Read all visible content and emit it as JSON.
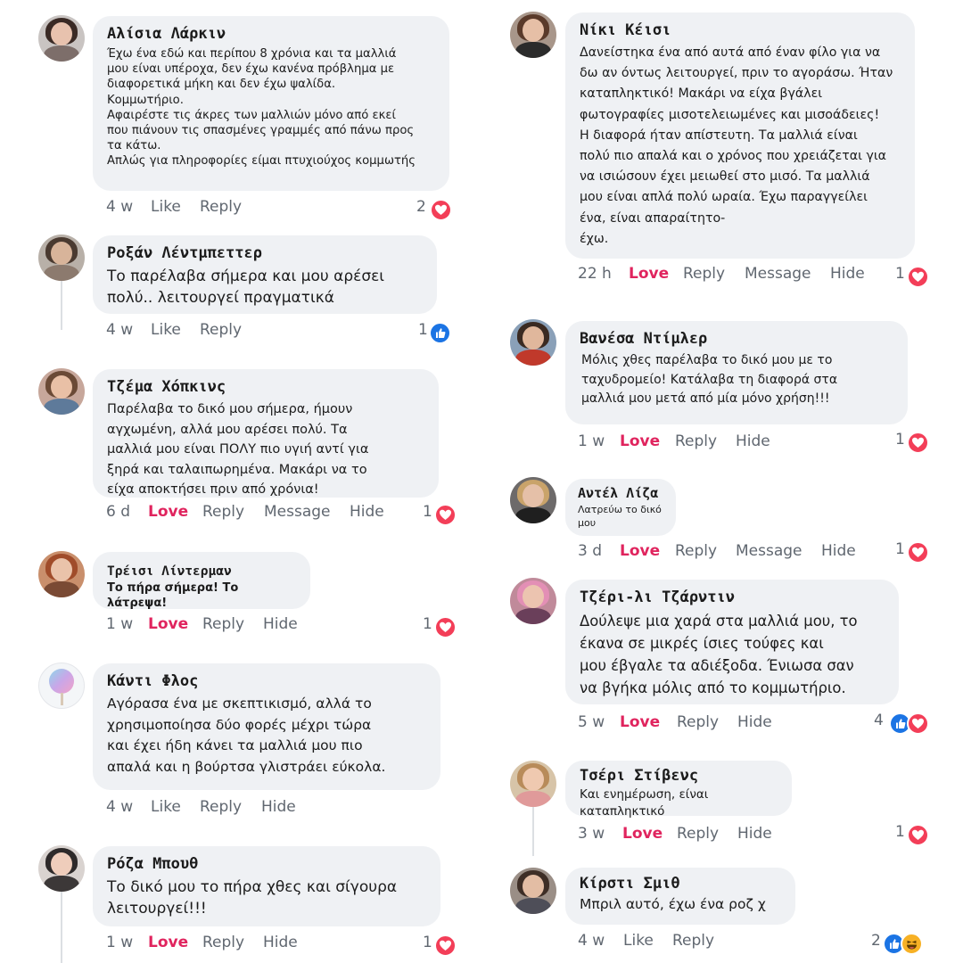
{
  "left": [
    {
      "author": "Αλίσια Λάρκιν",
      "text": "Έχω ένα εδώ και περίπου 8 χρόνια και τα μαλλιά\nμου είναι υπέροχα, δεν έχω κανένα πρόβλημα με\nδιαφορετικά μήκη και δεν έχω ψαλίδα.\nΚομμωτήριο.\nΑφαιρέστε τις άκρες των μαλλιών μόνο από εκεί\nπου πιάνουν τις σπασμένες γραμμές από πάνω προς\nτα κάτω.\nΑπλώς για πληροφορίες είμαι πτυχιούχος κομμωτής",
      "time": "4 w",
      "a1": "Like",
      "a2": "Reply",
      "count": "2"
    },
    {
      "author": "Ροξάν Λέντμπεττερ",
      "text": "Το παρέλαβα σήμερα και μου αρέσει\nπολύ.. λειτουργεί πραγματικά",
      "time": "4 w",
      "a1": "Like",
      "a2": "Reply",
      "count": "1"
    },
    {
      "author": "Τζέμα Χόπκινς",
      "text": "Παρέλαβα το δικό μου σήμερα, ήμουν\nαγχωμένη, αλλά μου αρέσει πολύ. Τα\nμαλλιά μου είναι ΠΟΛΥ πιο υγιή αντί για\nξηρά και ταλαιπωρημένα. Μακάρι να το\nείχα αποκτήσει πριν από χρόνια!",
      "time": "6 d",
      "a1": "Love",
      "a2": "Reply",
      "a3": "Message",
      "a4": "Hide",
      "count": "1"
    },
    {
      "author": "Τρέισι Λίντερμαν",
      "text": "Το πήρα σήμερα! Το λάτρεψα!",
      "time": "1 w",
      "a1": "Love",
      "a2": "Reply",
      "a3": "Hide",
      "count": "1"
    },
    {
      "author": "Κάντι Φλος",
      "text": "Αγόρασα ένα με σκεπτικισμό, αλλά το\nχρησιμοποίησα δύο φορές μέχρι τώρα\nκαι έχει ήδη κάνει τα μαλλιά μου πιο\nαπαλά και η βούρτσα γλιστράει εύκολα.",
      "time": "4 w",
      "a1": "Like",
      "a2": "Reply",
      "a3": "Hide"
    },
    {
      "author": "Ρόζα Μπουθ",
      "text": "Το δικό μου το πήρα χθες και σίγουρα\nλειτουργεί!!!",
      "time": "1 w",
      "a1": "Love",
      "a2": "Reply",
      "a3": "Hide",
      "count": "1"
    }
  ],
  "right": [
    {
      "author": "Νίκι Κέισι",
      "text": "Δανείστηκα ένα από αυτά από έναν φίλο για να\nδω αν όντως λειτουργεί, πριν το αγοράσω. Ήταν\nκαταπληκτικό! Μακάρι να είχα βγάλει\nφωτογραφίες μισοτελειωμένες και μισοάδειες!\nΗ διαφορά ήταν απίστευτη. Τα μαλλιά είναι\nπολύ πιο απαλά και ο χρόνος που χρειάζεται για\nνα ισιώσουν έχει μειωθεί στο μισό. Τα μαλλιά\nμου είναι απλά πολύ ωραία. Έχω παραγγείλει\nένα, είναι απαραίτητο-\nέχω.",
      "time": "22 h",
      "a1": "Love",
      "a2": "Reply",
      "a3": "Message",
      "a4": "Hide",
      "count": "1"
    },
    {
      "author": "Βανέσα Ντίμλερ",
      "text": "Μόλις χθες παρέλαβα το δικό μου με το\nταχυδρομείο! Κατάλαβα τη διαφορά στα\nμαλλιά μου μετά από μία μόνο χρήση!!!",
      "time": "1 w",
      "a1": "Love",
      "a2": "Reply",
      "a3": "Hide",
      "count": "1"
    },
    {
      "author": "Αντέλ Λίζα",
      "text": "Λατρεύω το δικό\nμου",
      "time": "3 d",
      "a1": "Love",
      "a2": "Reply",
      "a3": "Message",
      "a4": "Hide",
      "count": "1"
    },
    {
      "author": "Τζέρι-λι Τζάρντιν",
      "text": "Δούλεψε μια χαρά στα μαλλιά μου, το\nέκανα σε μικρές ίσιες τούφες και\nμου έβγαλε τα αδιέξοδα. Ένιωσα σαν\nνα βγήκα μόλις από το κομμωτήριο.",
      "time": "5 w",
      "a1": "Love",
      "a2": "Reply",
      "a3": "Hide",
      "count": "4"
    },
    {
      "author": "Τσέρι Στίβενς",
      "text": "Και ενημέρωση, είναι\nκαταπληκτικό",
      "time": "3 w",
      "a1": "Love",
      "a2": "Reply",
      "a3": "Hide",
      "count": "1"
    },
    {
      "author": "Κίρστι Σμιθ",
      "text": "Μπριλ αυτό, έχω ένα ροζ χ",
      "time": "4 w",
      "a1": "Like",
      "a2": "Reply",
      "count": "2"
    }
  ],
  "colors": {
    "bubble": "#eff1f4",
    "love": "#e0245e",
    "meta": "#606770",
    "heart": "#f33e58",
    "like": "#1b74e4",
    "haha": "#f7b125"
  }
}
